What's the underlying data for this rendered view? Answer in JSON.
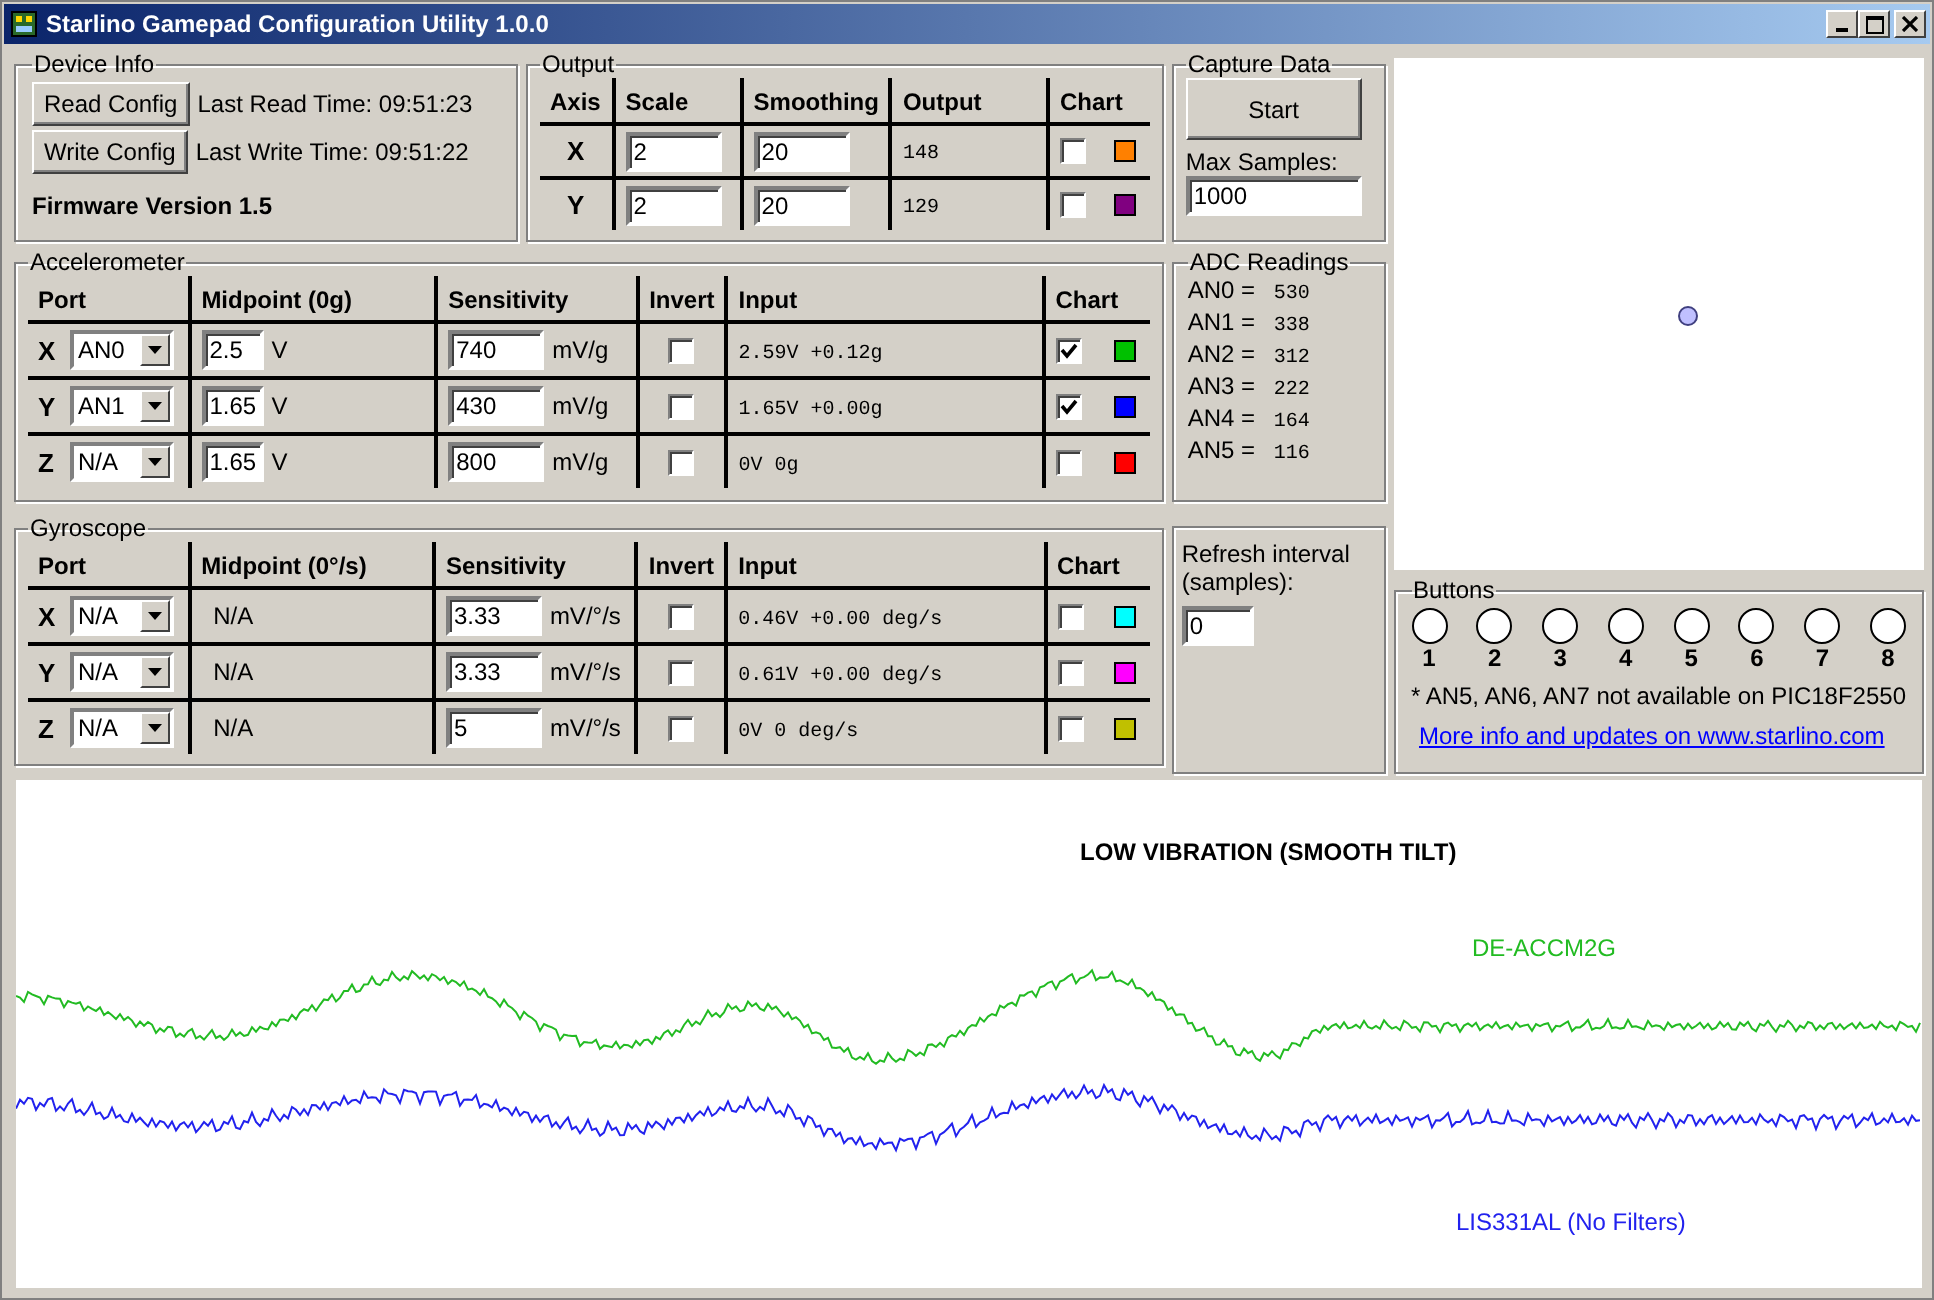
{
  "window": {
    "title": "Starlino Gamepad Configuration Utility 1.0.0"
  },
  "device_info": {
    "title": "Device Info",
    "read_button": "Read Config",
    "read_time": "Last Read Time: 09:51:23",
    "write_button": "Write Config",
    "write_time": "Last Write Time: 09:51:22",
    "firmware": "Firmware Version 1.5"
  },
  "output": {
    "title": "Output",
    "columns": [
      "Axis",
      "Scale",
      "Smoothing",
      "Output",
      "Chart"
    ],
    "rows": [
      {
        "axis": "X",
        "scale": "2",
        "smoothing": "20",
        "output": "148",
        "chart": false,
        "color": "#ff8000"
      },
      {
        "axis": "Y",
        "scale": "2",
        "smoothing": "20",
        "output": "129",
        "chart": false,
        "color": "#800080"
      }
    ]
  },
  "accelerometer": {
    "title": "Accelerometer",
    "columns": [
      "Port",
      "Midpoint (0g)",
      "Sensitivity",
      "Invert",
      "Input",
      "Chart"
    ],
    "rows": [
      {
        "axis": "X",
        "port": "AN0",
        "kind": "field",
        "midpoint": "2.5",
        "midpoint_unit": "V",
        "sensitivity": "740",
        "unit": "mV/g",
        "invert": false,
        "input": "2.59V +0.12g",
        "chart": true,
        "color": "#00c000"
      },
      {
        "axis": "Y",
        "port": "AN1",
        "kind": "field",
        "midpoint": "1.65",
        "midpoint_unit": "V",
        "sensitivity": "430",
        "unit": "mV/g",
        "invert": false,
        "input": "1.65V +0.00g",
        "chart": true,
        "color": "#0000ff"
      },
      {
        "axis": "Z",
        "port": "N/A",
        "kind": "field",
        "midpoint": "1.65",
        "midpoint_unit": "V",
        "sensitivity": "800",
        "unit": "mV/g",
        "invert": false,
        "input": "0V 0g",
        "chart": false,
        "color": "#ff0000"
      }
    ]
  },
  "gyroscope": {
    "title": "Gyroscope",
    "columns": [
      "Port",
      "Midpoint (0°/s)",
      "Sensitivity",
      "Invert",
      "Input",
      "Chart"
    ],
    "rows": [
      {
        "axis": "X",
        "port": "N/A",
        "kind": "text",
        "midpoint": "N/A",
        "sensitivity": "3.33",
        "unit": "mV/°/s",
        "invert": false,
        "input": "0.46V +0.00 deg/s",
        "chart": false,
        "color": "#00ffff"
      },
      {
        "axis": "Y",
        "port": "N/A",
        "kind": "text",
        "midpoint": "N/A",
        "sensitivity": "3.33",
        "unit": "mV/°/s",
        "invert": false,
        "input": "0.61V +0.00 deg/s",
        "chart": false,
        "color": "#ff00ff"
      },
      {
        "axis": "Z",
        "port": "N/A",
        "kind": "text",
        "midpoint": "N/A",
        "sensitivity": "5",
        "unit": "mV/°/s",
        "invert": false,
        "input": "0V 0 deg/s",
        "chart": false,
        "color": "#c0c000"
      }
    ]
  },
  "capture": {
    "title": "Capture Data",
    "button": "Start",
    "max_label": "Max Samples:",
    "max_value": "1000"
  },
  "adc": {
    "title": "ADC Readings",
    "readings": [
      {
        "label": "AN0 =",
        "value": "530"
      },
      {
        "label": "AN1 =",
        "value": "338"
      },
      {
        "label": "AN2 =",
        "value": "312"
      },
      {
        "label": "AN3 =",
        "value": "222"
      },
      {
        "label": "AN4 =",
        "value": "164"
      },
      {
        "label": "AN5 =",
        "value": "116"
      }
    ]
  },
  "refresh": {
    "label": "Refresh interval (samples):",
    "value": "0"
  },
  "buttons": {
    "title": "Buttons",
    "items": [
      {
        "label": "1",
        "pressed": false
      },
      {
        "label": "2",
        "pressed": false
      },
      {
        "label": "3",
        "pressed": false
      },
      {
        "label": "4",
        "pressed": false
      },
      {
        "label": "5",
        "pressed": false
      },
      {
        "label": "6",
        "pressed": false
      },
      {
        "label": "7",
        "pressed": false
      },
      {
        "label": "8",
        "pressed": false
      }
    ],
    "note": "* AN5, AN6, AN7 not available on PIC18F2550",
    "link": "More info and updates on www.starlino.com"
  },
  "chart": {
    "title": "LOW VIBRATION (SMOOTH TILT)",
    "series": [
      {
        "name": "DE-ACCM2G",
        "color": "#22bb22"
      },
      {
        "name": "LIS331AL (No Filters)",
        "color": "#2222ee"
      }
    ]
  }
}
